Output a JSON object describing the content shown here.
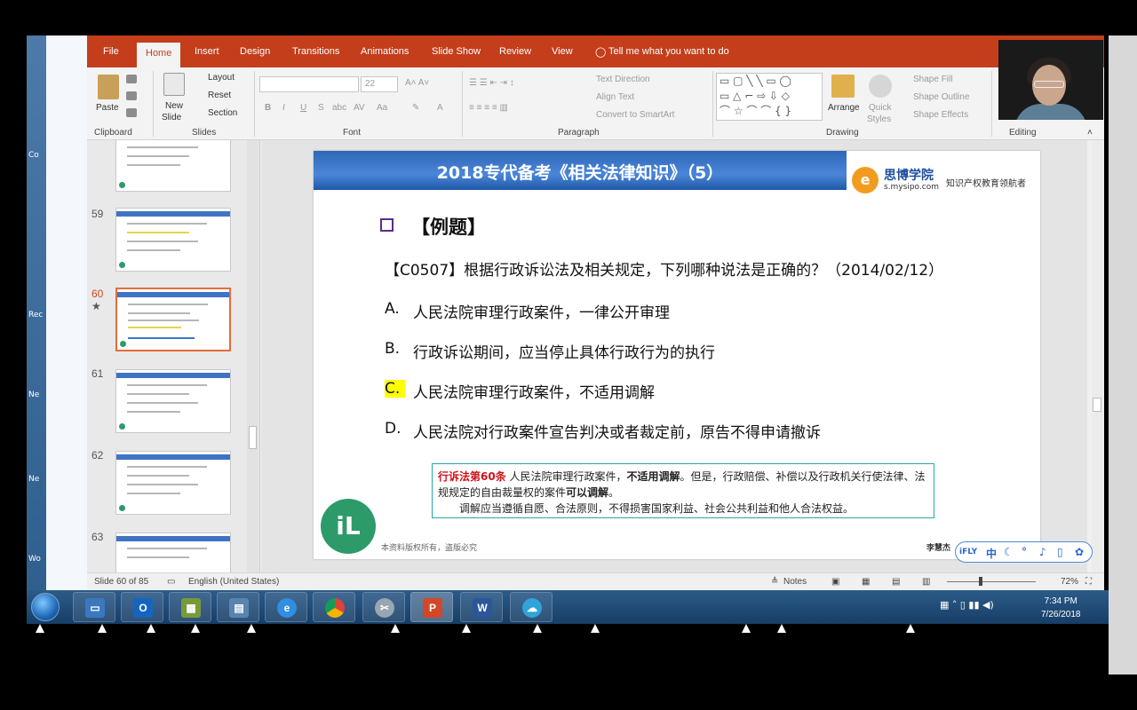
{
  "ppt": {
    "tabs": [
      "File",
      "Home",
      "Insert",
      "Design",
      "Transitions",
      "Animations",
      "Slide Show",
      "Review",
      "View"
    ],
    "tell_me": "Tell me what you want to do",
    "ribbon": {
      "paste": "Paste",
      "new_slide": "New",
      "new_slide2": "Slide",
      "layout": "Layout",
      "reset": "Reset",
      "section": "Section",
      "font_size": "22",
      "text_direction": "Text Direction",
      "align_text": "Align Text",
      "convert_smartart": "Convert to SmartArt",
      "arrange": "Arrange",
      "quick_styles": "Quick",
      "quick_styles2": "Styles",
      "shape_fill": "Shape Fill",
      "shape_outline": "Shape Outline",
      "shape_effects": "Shape Effects",
      "groups": [
        "Clipboard",
        "Slides",
        "Font",
        "Paragraph",
        "Drawing",
        "Editing"
      ]
    },
    "thumbnails": [
      "59",
      "60",
      "61",
      "62",
      "63"
    ],
    "selected_thumbnail": "60",
    "status": {
      "slide_of": "Slide 60 of 85",
      "language": "English (United States)",
      "notes": "Notes",
      "zoom": "72%"
    }
  },
  "slide": {
    "banner_title": "2018专代备考《相关法律知识》（5）",
    "brand_name": "思博学院",
    "brand_url": "s.mysipo.com",
    "brand_slogan": "知识产权教育领航者",
    "example_title": "【例题】",
    "question": "【C0507】根据行政诉讼法及相关规定，下列哪种说法是正确的？（2014/02/12）",
    "options": [
      {
        "letter": "A.",
        "text": "人民法院审理行政案件，一律公开审理"
      },
      {
        "letter": "B.",
        "text": "行政诉讼期间，应当停止具体行政行为的执行"
      },
      {
        "letter": "C.",
        "text": "人民法院审理行政案件，不适用调解"
      },
      {
        "letter": "D.",
        "text": "人民法院对行政案件宣告判决或者裁定前，原告不得申请撤诉"
      }
    ],
    "law": {
      "article": "行诉法第60条",
      "p1": " 人民法院审理行政案件，",
      "p1b": "不适用调解",
      "p1c": "。但是，行政赔偿、补偿以及行政机关行使法律、法规规定的自由裁量权的案件",
      "p1d": "可以调解",
      "p1e": "。",
      "p2": "调解应当遵循自愿、合法原则，不得损害国家利益、社会公共利益和他人合法权益。"
    },
    "footer": "本资料版权所有，盗版必究",
    "author": "李慧杰"
  },
  "ifly": {
    "label": "iFLY",
    "lang": "中"
  },
  "taskbar": {
    "time": "7:34 PM",
    "date": "7/26/2018"
  },
  "desktop": {
    "items": [
      "Co",
      "Rec",
      "Ne",
      "Ne",
      "Wo"
    ]
  },
  "colors": {
    "ppt_accent": "#c43e1c",
    "banner_blue": "#3f74c5",
    "highlight": "#ffff00"
  }
}
